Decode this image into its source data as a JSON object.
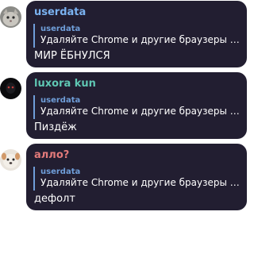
{
  "messages": [
    {
      "author": "userdata",
      "author_color": "#7ab2f0",
      "avatar": "cat-avatar",
      "reply": {
        "author": "userdata",
        "text": "Удаляйте Chrome и другие браузеры на ..."
      },
      "text": "МИР ЁБНУЛСЯ"
    },
    {
      "author": "luxora kun",
      "author_color": "#5fc7b3",
      "avatar": "dark-avatar",
      "reply": {
        "author": "userdata",
        "text": "Удаляйте Chrome и другие браузеры на ..."
      },
      "text": "Пиздёж"
    },
    {
      "author": "алло?",
      "author_color": "#e27a7a",
      "avatar": "dog-avatar",
      "reply": {
        "author": "userdata",
        "text": "Удаляйте Chrome и другие браузеры на ..."
      },
      "text": "дефолт"
    }
  ],
  "colors": {
    "bubble": "#221e31",
    "reply_accent": "#6f9ed9",
    "text": "#ffffff"
  }
}
